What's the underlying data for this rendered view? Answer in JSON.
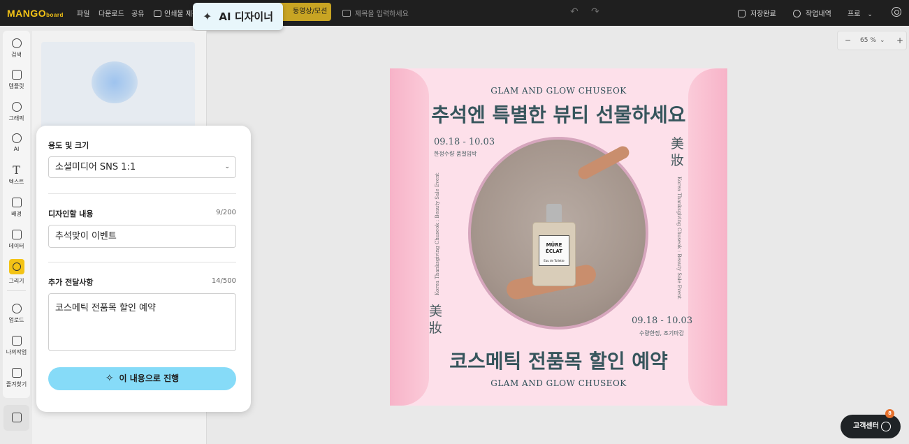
{
  "topbar": {
    "logo_main": "MANGO",
    "logo_sub": "board",
    "menu": [
      "파일",
      "다운로드",
      "공유"
    ],
    "print_label": "인쇄물 제작",
    "motion_label": "동영상/모션",
    "title_placeholder": "제목을 입력하세요",
    "save_status": "저장완료",
    "history_label": "작업내역",
    "plan_label": "프로"
  },
  "ai_badge": {
    "label": "AI 디자이너"
  },
  "sidebar": {
    "items": [
      {
        "label": "검색",
        "icon": "search-icon"
      },
      {
        "label": "템플릿",
        "icon": "template-icon"
      },
      {
        "label": "그래픽",
        "icon": "graphic-icon"
      },
      {
        "label": "AI",
        "icon": "ai-icon"
      },
      {
        "label": "텍스트",
        "icon": "text-icon"
      },
      {
        "label": "배경",
        "icon": "background-icon"
      },
      {
        "label": "데이터",
        "icon": "chart-icon"
      },
      {
        "label": "그리기",
        "icon": "draw-icon"
      },
      {
        "label": "업로드",
        "icon": "upload-icon"
      },
      {
        "label": "나의작업",
        "icon": "my-work-icon"
      },
      {
        "label": "즐겨찾기",
        "icon": "favorite-icon"
      }
    ]
  },
  "dialog": {
    "purpose_label": "용도 및 크기",
    "purpose_value": "소셜미디어 SNS 1:1",
    "content_label": "디자인할 내용",
    "content_counter": "9/200",
    "content_value": "추석맞이 이벤트",
    "extra_label": "추가 전달사항",
    "extra_counter": "14/500",
    "extra_value": "코스메틱 전품목 할인 예약",
    "proceed_label": "이 내용으로 진행"
  },
  "zoom": {
    "minus": "−",
    "value": "65 %",
    "plus": "+"
  },
  "canvas": {
    "top_sub": "GLAM AND GLOW CHUSEOK",
    "headline": "추석엔 특별한 뷰티 선물하세요",
    "date_left": "09.18 - 10.03",
    "note_left": "한정수량 품절임박",
    "hanja_right": "美\n妝",
    "vert_text": "Korea Thanksgiving Chuseok : Beauty Sale Event",
    "hanja_left": "美\n妝",
    "date_right": "09.18 - 10.03",
    "note_right": "수량한정, 조기마감",
    "bottom_head": "코스메틱 전품목 할인 예약",
    "bottom_sub": "GLAM AND GLOW CHUSEOK",
    "bottle_brand_1": "MÛRE",
    "bottle_brand_2": "ÉCLAT",
    "bottle_type": "Eau de Toilette"
  },
  "support": {
    "label": "고객센터",
    "badge": "8"
  },
  "colors": {
    "accent": "#f3c316",
    "topbar": "#1f1f1f",
    "proceed": "#86dbf8",
    "canvas_bg": "#fde0ea",
    "headline": "#36555c"
  }
}
